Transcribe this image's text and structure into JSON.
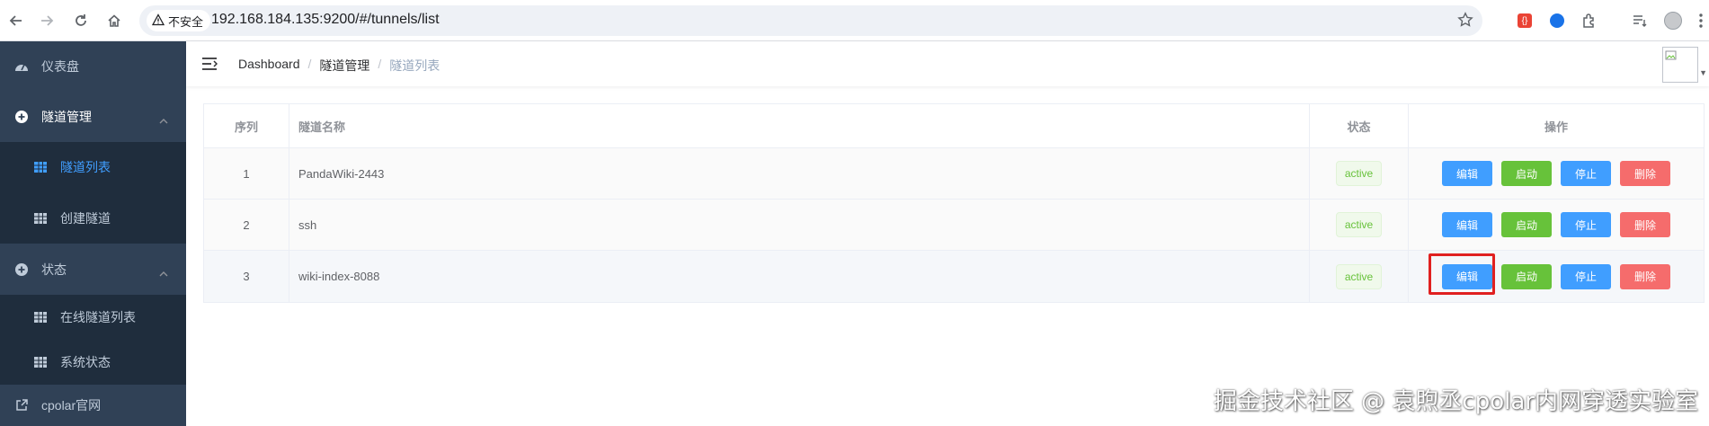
{
  "browser": {
    "security_label": "不安全",
    "url": "192.168.184.135:9200/#/tunnels/list",
    "icons": [
      "back-icon",
      "forward-icon",
      "reload-icon",
      "home-icon",
      "star-icon",
      "extension-icon",
      "profile-icon",
      "menu-icon"
    ]
  },
  "sidebar": {
    "items": [
      {
        "label": "仪表盘",
        "icon": "dashboard-icon"
      },
      {
        "label": "隧道管理",
        "icon": "plus-circle-icon",
        "expanded": true
      },
      {
        "label": "隧道列表",
        "icon": "grid-icon",
        "active": true
      },
      {
        "label": "创建隧道",
        "icon": "grid-icon"
      },
      {
        "label": "状态",
        "icon": "plus-circle-icon",
        "expanded": true
      },
      {
        "label": "在线隧道列表",
        "icon": "grid-icon"
      },
      {
        "label": "系统状态",
        "icon": "grid-icon"
      },
      {
        "label": "cpolar官网",
        "icon": "external-link-icon"
      }
    ],
    "colors": {
      "bg": "#304156",
      "sub_bg": "#1f2d3d",
      "text": "#bfcbd9",
      "active": "#409eff"
    }
  },
  "breadcrumb": {
    "items": [
      "Dashboard",
      "隧道管理",
      "隧道列表"
    ],
    "separator": "/"
  },
  "table": {
    "headers": {
      "index": "序列",
      "name": "隧道名称",
      "status": "状态",
      "ops": "操作"
    },
    "rows": [
      {
        "index": "1",
        "name": "PandaWiki-2443",
        "status": "active"
      },
      {
        "index": "2",
        "name": "ssh",
        "status": "active"
      },
      {
        "index": "3",
        "name": "wiki-index-8088",
        "status": "active"
      }
    ],
    "actions": {
      "edit": "编辑",
      "start": "启动",
      "stop": "停止",
      "delete": "删除"
    }
  },
  "watermark": "掘金技术社区 @ 袁煦丞cpolar内网穿透实验室"
}
